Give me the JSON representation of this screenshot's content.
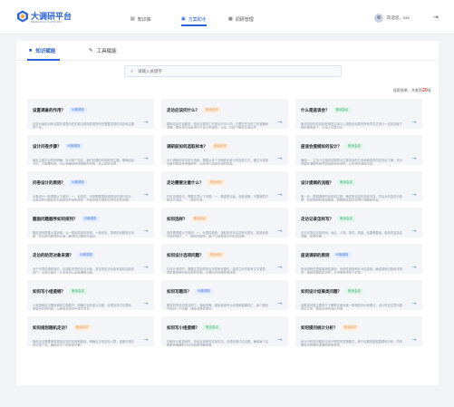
{
  "app": {
    "logo_title": "大调研平台",
    "logo_subtitle": "RESEARCH PLATFORM"
  },
  "nav": [
    {
      "label": "知识库",
      "icon": "book-icon",
      "active": false
    },
    {
      "label": "方案助手",
      "icon": "assistant-icon",
      "active": true
    },
    {
      "label": "调研管理",
      "icon": "manage-icon",
      "active": false
    }
  ],
  "user": {
    "greeting": "欢迎您，xxx"
  },
  "tabs": [
    {
      "label": "知识赋能",
      "icon": "folder-icon",
      "active": true
    },
    {
      "label": "工具赋能",
      "icon": "wrench-icon",
      "active": false
    }
  ],
  "search": {
    "placeholder": "请输入关键字"
  },
  "results": {
    "prefix": "搜索结果，共查到",
    "count": "20",
    "suffix": "条"
  },
  "colors": {
    "accent": "#2e63d6",
    "tag_blue": "#3a6fdc",
    "tag_green": "#27a765",
    "tag_orange": "#e8852e"
  },
  "cards": [
    {
      "title": "设置调查的作用？",
      "tag": "问卷调查",
      "tag_color": "blue",
      "desc": "这是对每的对有点展开重叠内在的调当调用发现所所的需要发现的内容和主要的工作。"
    },
    {
      "title": "走访应该问什么？",
      "tag": "座谈走访",
      "tag_color": "orange",
      "desc": "要制定走访话题前，想走访调查工作是必不可少的。它要在在当前工作准备和准备，要对走访对象进行了深入的调查，以及，切实了解并认真向它"
    },
    {
      "title": "什么是座谈会？",
      "tag": "座谈会议",
      "tag_color": "green",
      "desc": "座谈会是在的目标有调查主体与上调查目标群的所有学员式进行一名的场景了组织调查者了，主持人引导讨论。"
    },
    {
      "title": "设计问卷步骤？",
      "tag": "问卷调查",
      "tag_color": "blue",
      "desc": "确定主题与目的的明确，针对某个特定，我们将要的时候考虑主题，明确目标方向。主题需清晰，可以准确地说明调研的目的，并以回答清楚。"
    },
    {
      "title": "调研前如何选取样本？",
      "tag": "座谈走访",
      "tag_color": "orange",
      "desc": "对于调研的样本进行选取，需要从多个方面着手进行的选择方式，通过对调查对象的整体考虑和研究，从而进行选取合适的样本。"
    },
    {
      "title": "座谈会提纲如何设计？",
      "tag": "座谈会议",
      "tag_color": "green",
      "desc": "确保一、主持人在组织前期须对主题涉及的方向和调查的内容完全了解，充分掌握好调研的相关背景和参考资料，以及相关调研内容。"
    },
    {
      "title": "问卷设计的原则？",
      "tag": "问卷调查",
      "tag_color": "blue",
      "desc": "问卷设计一般遵循以下原则：一、目的性。问卷需要围绕调查目的进行设计，问卷中的问题均应与调查目的紧密相关，不能设置与调查目的无关的问题。"
    },
    {
      "title": "走访需要注意什么？",
      "tag": "座谈走访",
      "tag_color": "orange",
      "desc": "在走访调查中，需要注意以下问题：一、尊重受访者，态度诚恳，不要随意打断对方讲话。二、做好记录。"
    },
    {
      "title": "设计提纲的流程？",
      "tag": "座谈会议",
      "tag_color": "green",
      "desc": "第一步，根据调研的目的和主题，确定座谈会的具体内容，然后对内容进行梳理，形成提纲的基本框架，再根据实际情况进行调整和完善。"
    },
    {
      "title": "题面问题顺序如何排列？",
      "tag": "问卷调查",
      "tag_color": "blue",
      "desc": "题目排列遵循从易到难，从一般到具体的原则。一般来说，简单的问题放在前面，复杂的问题放在后面，敏感性问题放在最后。"
    },
    {
      "title": "如何选样？",
      "tag": "座谈走访",
      "tag_color": "orange",
      "desc": "选样需遵循以下原则：一、代表性原则：选取的样本应具有代表性，能够反映总体的特征。二、随机性原则：每个个体被选中的机会均等。"
    },
    {
      "title": "走访记录怎样写？",
      "tag": "座谈会议",
      "tag_color": "green",
      "desc": "走访记录应包括时间、地点、人物、事件、原因、结果等要素，做到内容真实准确，条理清晰。"
    },
    {
      "title": "走访的防范对象来源？",
      "tag": "问卷调查",
      "tag_color": "blue",
      "desc": "对于不同的调研目的，应选取不同的走访对象，常见的走访对象来源包括政府部门、企事业单位、社会组织以及普通群众等。"
    },
    {
      "title": "如何设计选项问题？",
      "tag": "座谈走访",
      "tag_color": "orange",
      "desc": "在设计选项时，需要注意选项的互斥性和完整性，选项之间不能有交叉重叠，同时要涵盖所有可能的答案，必要时可设置其他选项。"
    },
    {
      "title": "座谈调研的原则",
      "tag": "问卷调查",
      "tag_color": "blue",
      "desc": "座谈调研应遵循客观性原则、系统性原则和针对性原则，确保调研过程科学规范，调研结果真实可靠，为决策提供有力支撑。"
    },
    {
      "title": "如何写小组提纲？",
      "tag": "座谈会议",
      "tag_color": "green",
      "desc": "小组提纲应当围绕调研主题展开，明确讨论的重点问题，合理安排讨论顺序，预留充足的时间，以便参与者充分表达意见。"
    },
    {
      "title": "如何写题目？",
      "tag": "问卷调查",
      "tag_color": "blue",
      "desc": "题目的表述应简洁明了、通俗易懂，避免使用专业术语和模糊词汇，每个题目只询问一个问题，避免诱导性提问。"
    },
    {
      "title": "如何设计结果类问题？",
      "tag": "座谈会议",
      "tag_color": "green",
      "desc": "结果类问题主要用于了解受访者对某一事物的评价和看法，设计时应注意问题的中立性，提供合适的评价尺度。"
    },
    {
      "title": "如何规划随机走访？",
      "tag": "座谈走访",
      "tag_color": "orange",
      "desc": "随机走访需要提前规划走访的区域和路线，明确走访的目标人群，准备好相关的记录工具，确保走访工作有序开展。"
    },
    {
      "title": "如何写小组提纲？",
      "tag": "座谈会议",
      "tag_color": "green",
      "desc": "在编写小组提纲时，应结合调研的实际情况，合理设置讨论议题，确保每个议题都有明确的讨论目标和预期成果。"
    },
    {
      "title": "如何提问统计分析？",
      "tag": "座谈走访",
      "tag_color": "orange",
      "desc": "统计分析类问题应当设计规范的答题格式，便于后期的数据整理和分析，同时要保证数据的准确性和有效性。"
    }
  ]
}
